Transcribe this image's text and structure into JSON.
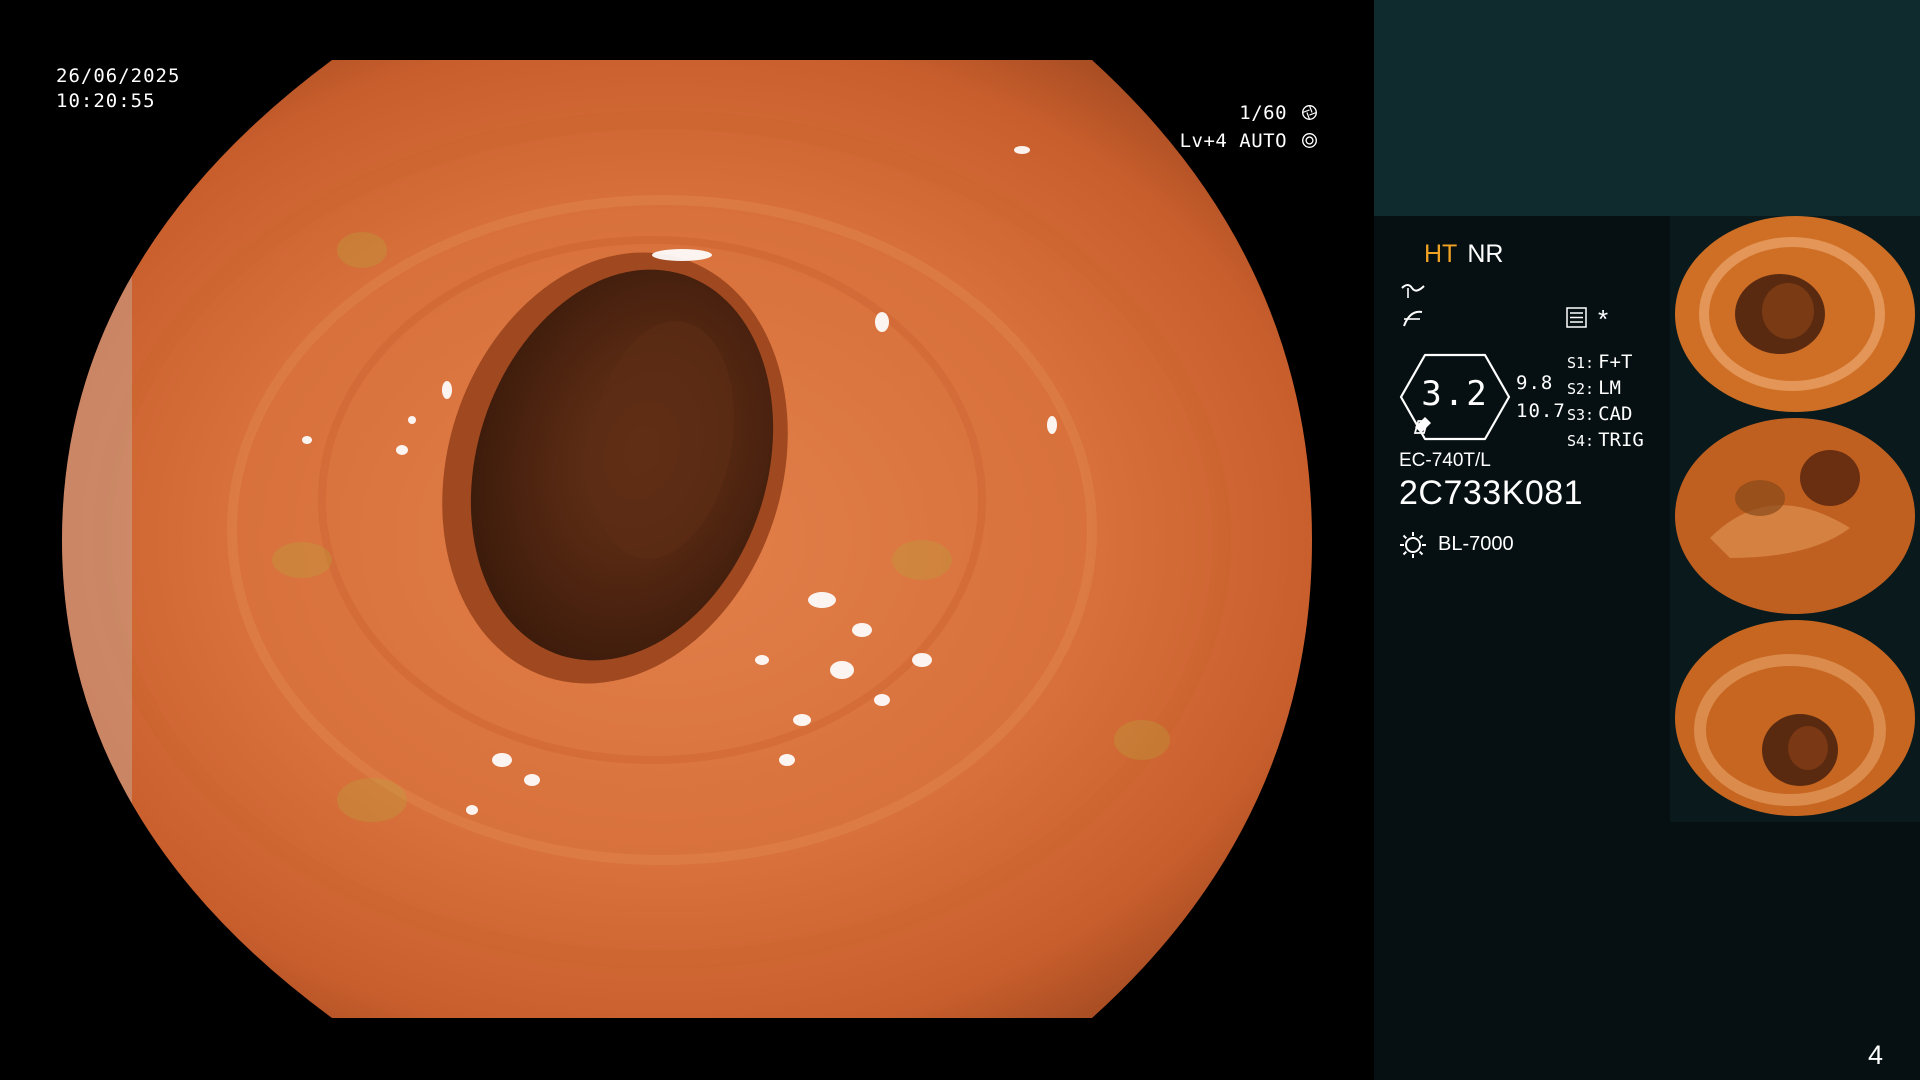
{
  "overlay": {
    "date": "26/06/2025",
    "time": "10:20:55",
    "shutter": "1/60",
    "shutter_icon": "shutter-icon",
    "level": "Lv+4 AUTO",
    "auto_icon": "auto-exposure-icon"
  },
  "panel": {
    "ht": "HT",
    "nr": "NR",
    "asterisk": "*",
    "zoom": "3.2",
    "zoom_right_top": "9.8",
    "zoom_right_bottom": "10.7",
    "sources": [
      {
        "key": "S1:",
        "value": "F+T"
      },
      {
        "key": "S2:",
        "value": "LM"
      },
      {
        "key": "S3:",
        "value": "CAD"
      },
      {
        "key": "S4:",
        "value": "TRIG"
      }
    ],
    "scope_model": "EC-740T/L",
    "scope_serial": "2C733K081",
    "light_source": "BL-7000",
    "page": "4"
  },
  "colors": {
    "panel_top": "#0f2b2e",
    "panel": "#061012",
    "ht_accent": "#f0a224",
    "mucosa": "#d9743a"
  }
}
